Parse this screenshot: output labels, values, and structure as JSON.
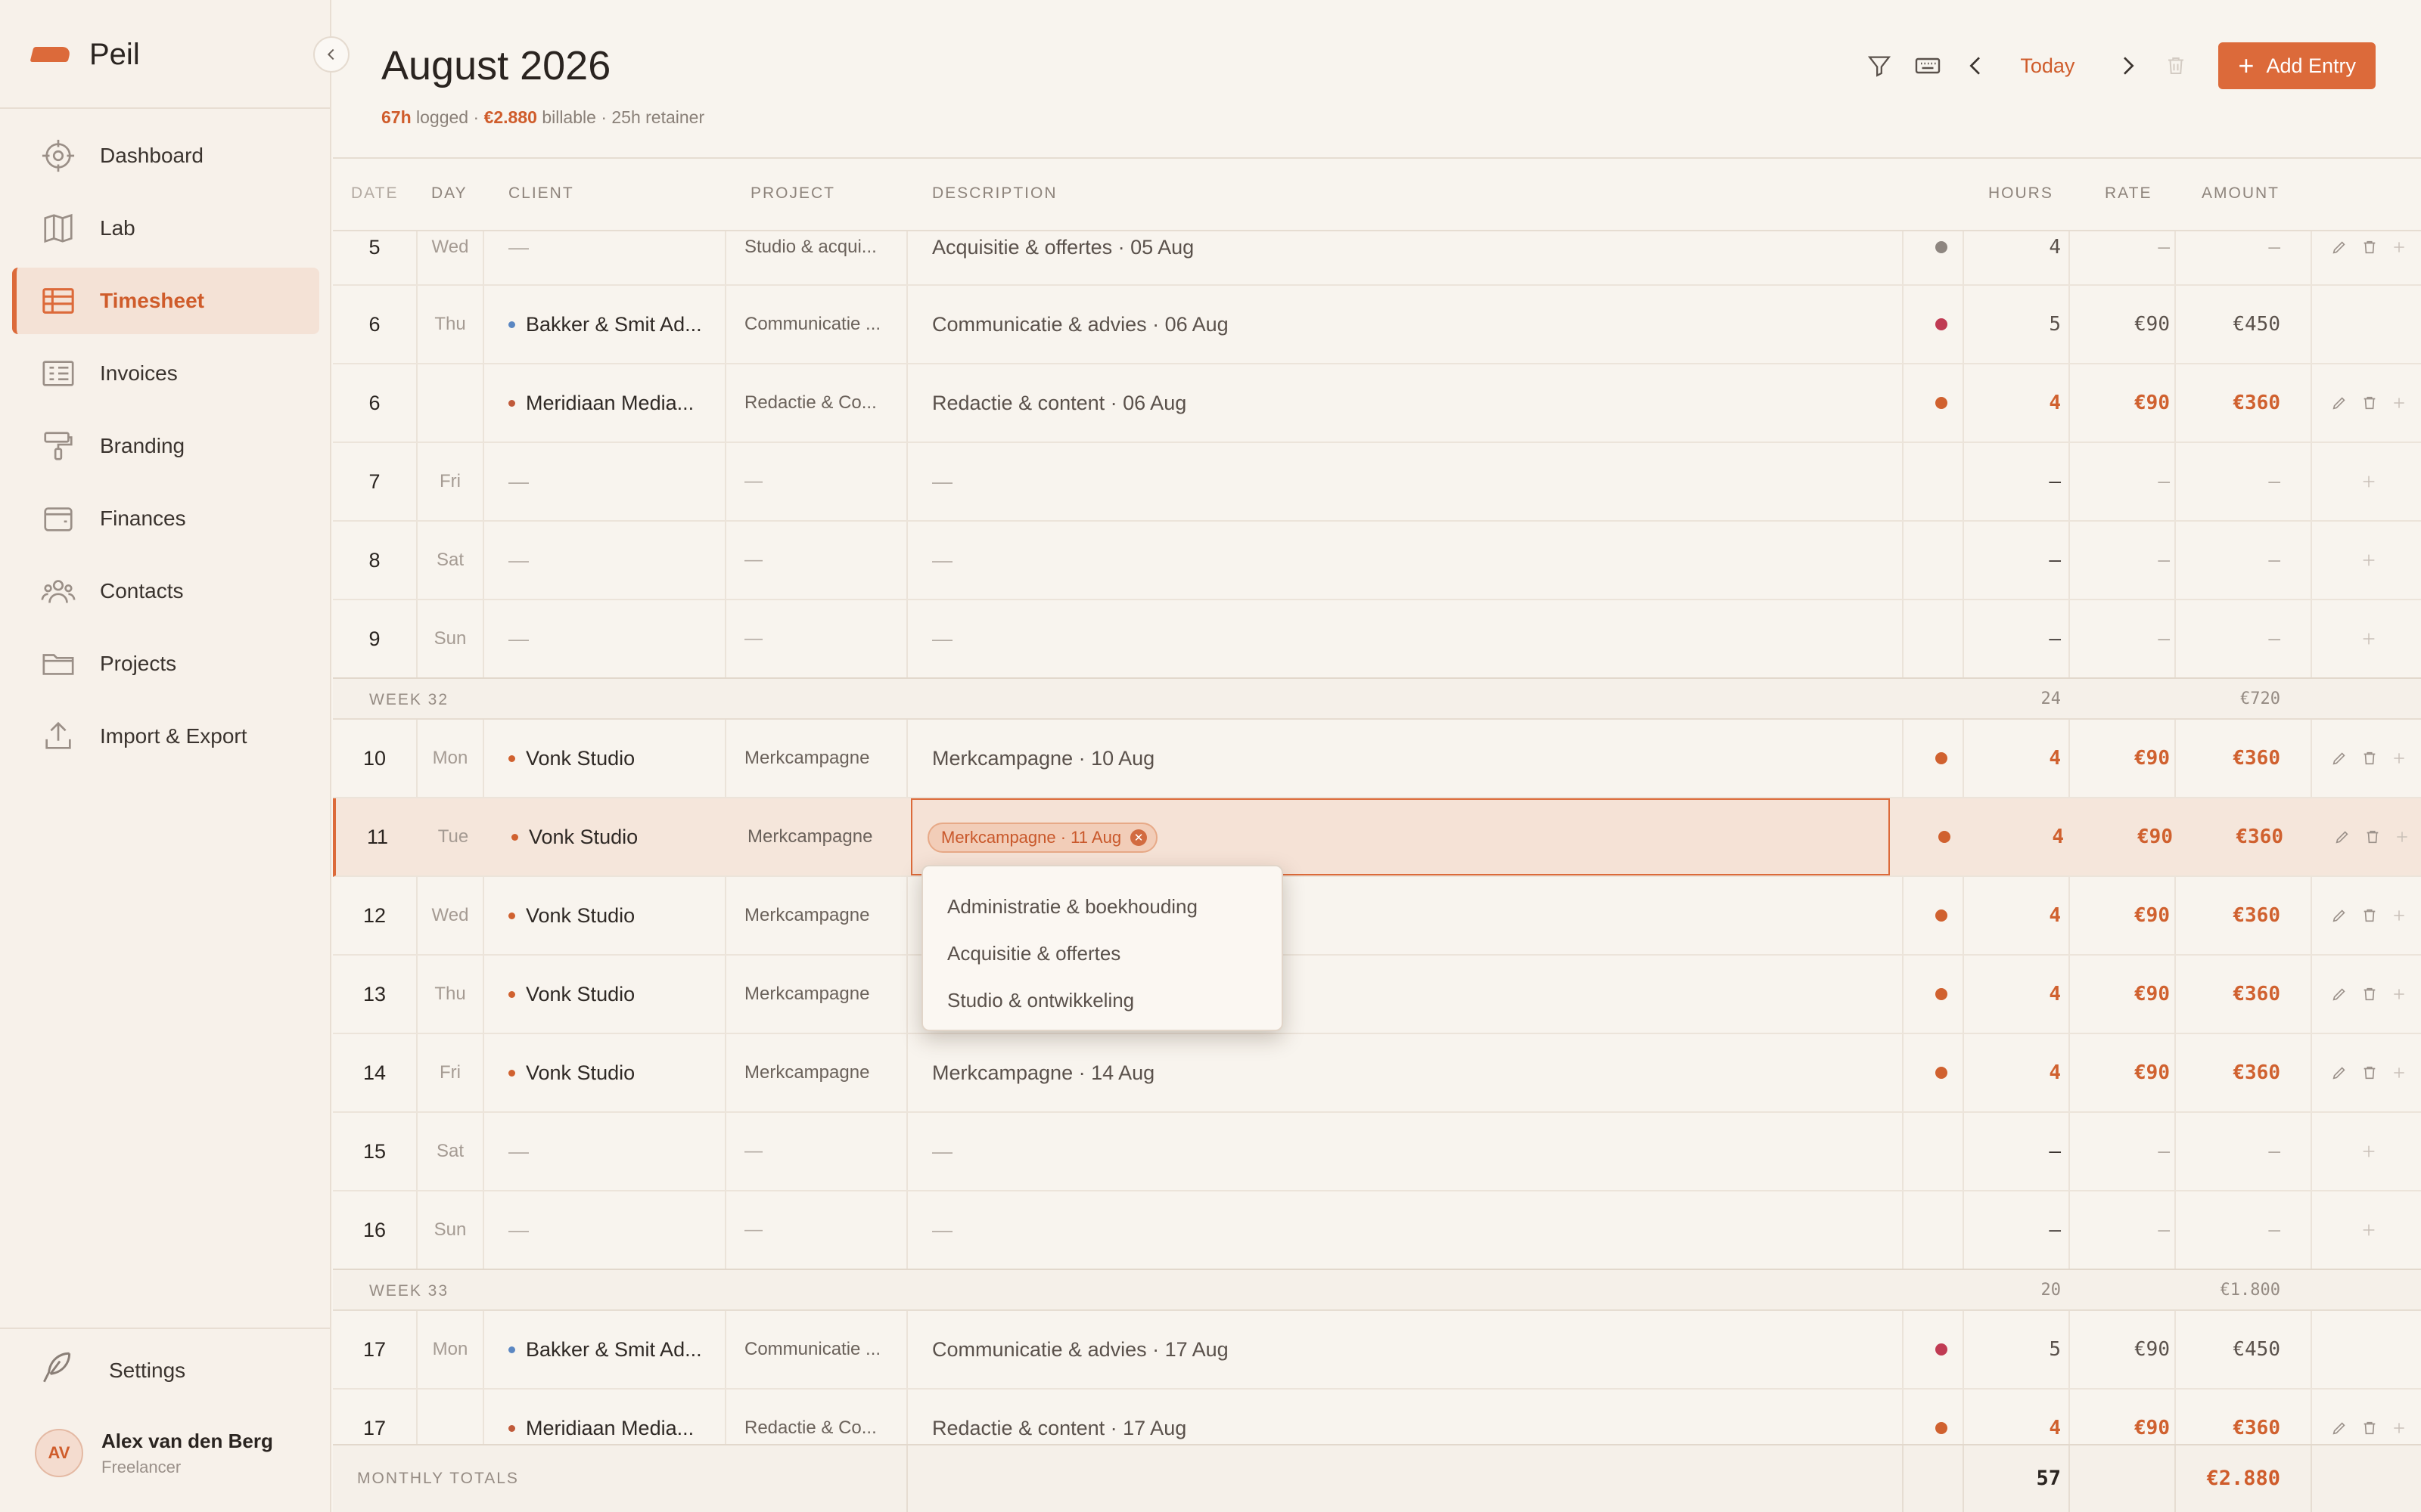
{
  "app": {
    "name": "Peil"
  },
  "sidebar": {
    "items": [
      {
        "label": "Dashboard",
        "icon": "crosshair-icon"
      },
      {
        "label": "Lab",
        "icon": "map-icon"
      },
      {
        "label": "Timesheet",
        "icon": "table-icon",
        "active": true
      },
      {
        "label": "Invoices",
        "icon": "invoice-icon"
      },
      {
        "label": "Branding",
        "icon": "paint-roller-icon"
      },
      {
        "label": "Finances",
        "icon": "wallet-icon"
      },
      {
        "label": "Contacts",
        "icon": "users-icon"
      },
      {
        "label": "Projects",
        "icon": "folder-icon"
      },
      {
        "label": "Import & Export",
        "icon": "upload-icon"
      }
    ],
    "settings_label": "Settings",
    "user": {
      "initials": "AV",
      "name": "Alex van den Berg",
      "role": "Freelancer"
    }
  },
  "header": {
    "title": "August 2026",
    "logged": "67h",
    "logged_label": "logged",
    "billable": "€2.880",
    "billable_label": "billable",
    "retainer": "25h retainer",
    "sep": "·",
    "today_label": "Today",
    "add_label": "Add Entry"
  },
  "table": {
    "headers": {
      "date": "DATE",
      "day": "DAY",
      "client": "CLIENT",
      "project": "PROJECT",
      "description": "DESCRIPTION",
      "hours": "HOURS",
      "rate": "RATE",
      "amount": "AMOUNT"
    },
    "rows": [
      {
        "date": "5",
        "day": "Wed",
        "client": "—",
        "project": "Studio & acqui...",
        "description": "Acquisitie & offertes · 05 Aug",
        "hours": "4",
        "rate": "—",
        "amount": "—"
      },
      {
        "date": "6",
        "day": "Thu",
        "client": "Bakker & Smit Ad...",
        "project": "Communicatie ...",
        "description": "Communicatie & advies · 06 Aug",
        "hours": "5",
        "rate": "€90",
        "amount": "€450"
      },
      {
        "date": "6",
        "day": "",
        "client": "Meridiaan Media...",
        "project": "Redactie & Co...",
        "description": "Redactie & content · 06 Aug",
        "hours": "4",
        "rate": "€90",
        "amount": "€360"
      },
      {
        "date": "7",
        "day": "Fri",
        "client": "—",
        "project": "—",
        "description": "—",
        "hours": "—",
        "rate": "—",
        "amount": "—"
      },
      {
        "date": "8",
        "day": "Sat",
        "client": "—",
        "project": "—",
        "description": "—",
        "hours": "—",
        "rate": "—",
        "amount": "—"
      },
      {
        "date": "9",
        "day": "Sun",
        "client": "—",
        "project": "—",
        "description": "—",
        "hours": "—",
        "rate": "—",
        "amount": "—"
      },
      {
        "date": "10",
        "day": "Mon",
        "client": "Vonk Studio",
        "project": "Merkcampagne",
        "description": "Merkcampagne · 10 Aug",
        "hours": "4",
        "rate": "€90",
        "amount": "€360"
      },
      {
        "date": "11",
        "day": "Tue",
        "client": "Vonk Studio",
        "project": "Merkcampagne",
        "description": "Merkcampagne · 11 Aug",
        "hours": "4",
        "rate": "€90",
        "amount": "€360"
      },
      {
        "date": "12",
        "day": "Wed",
        "client": "Vonk Studio",
        "project": "Merkcampagne",
        "description": "",
        "hours": "4",
        "rate": "€90",
        "amount": "€360"
      },
      {
        "date": "13",
        "day": "Thu",
        "client": "Vonk Studio",
        "project": "Merkcampagne",
        "description": "",
        "hours": "4",
        "rate": "€90",
        "amount": "€360"
      },
      {
        "date": "14",
        "day": "Fri",
        "client": "Vonk Studio",
        "project": "Merkcampagne",
        "description": "Merkcampagne · 14 Aug",
        "hours": "4",
        "rate": "€90",
        "amount": "€360"
      },
      {
        "date": "15",
        "day": "Sat",
        "client": "—",
        "project": "—",
        "description": "—",
        "hours": "—",
        "rate": "—",
        "amount": "—"
      },
      {
        "date": "16",
        "day": "Sun",
        "client": "—",
        "project": "—",
        "description": "—",
        "hours": "—",
        "rate": "—",
        "amount": "—"
      },
      {
        "date": "17",
        "day": "Mon",
        "client": "Bakker & Smit Ad...",
        "project": "Communicatie ...",
        "description": "Communicatie & advies · 17 Aug",
        "hours": "5",
        "rate": "€90",
        "amount": "€450"
      },
      {
        "date": "17",
        "day": "",
        "client": "Meridiaan Media...",
        "project": "Redactie & Co...",
        "description": "Redactie & content · 17 Aug",
        "hours": "4",
        "rate": "€90",
        "amount": "€360"
      }
    ],
    "weeks": [
      {
        "label": "WEEK 32",
        "hours": "24",
        "amount": "€720"
      },
      {
        "label": "WEEK 33",
        "hours": "20",
        "amount": "€1.800"
      }
    ],
    "dropdown_options": [
      "Administratie & boekhouding",
      "Acquisitie & offertes",
      "Studio & ontwikkeling"
    ],
    "footer": {
      "label": "MONTHLY TOTALS",
      "hours": "57",
      "amount": "€2.880"
    }
  },
  "colors": {
    "accent": "#dc6a3a",
    "client_blue": "#5b87c2",
    "client_red": "#c03b53",
    "client_orange": "#d0612f",
    "neutral_dot": "#8e8680"
  }
}
